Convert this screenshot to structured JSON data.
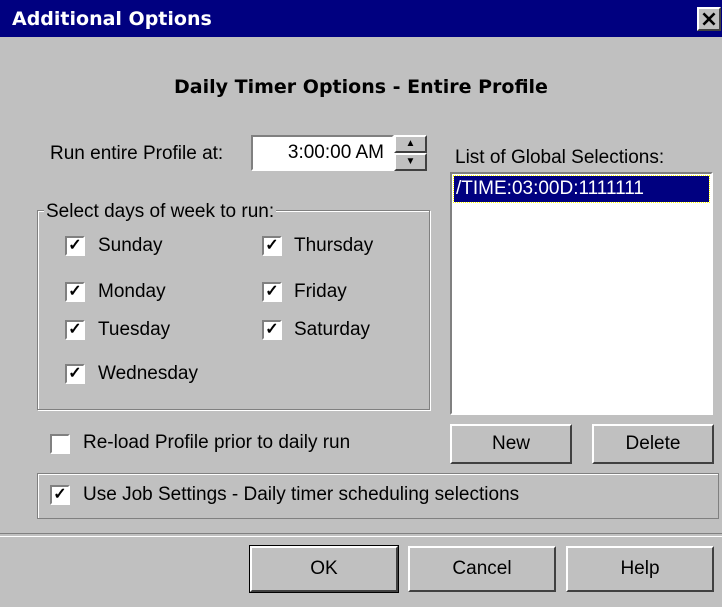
{
  "window": {
    "title": "Additional Options",
    "close_glyph": "×"
  },
  "heading": "Daily Timer Options - Entire Profile",
  "run_at": {
    "label": "Run entire Profile at:",
    "value": "3:00:00 AM"
  },
  "days_group": {
    "label": "Select days of week to run:",
    "days": [
      {
        "name": "Sunday",
        "checked": true
      },
      {
        "name": "Monday",
        "checked": true
      },
      {
        "name": "Tuesday",
        "checked": true
      },
      {
        "name": "Wednesday",
        "checked": true
      },
      {
        "name": "Thursday",
        "checked": true
      },
      {
        "name": "Friday",
        "checked": true
      },
      {
        "name": "Saturday",
        "checked": true
      }
    ]
  },
  "reload": {
    "label": "Re-load Profile prior to daily run",
    "checked": false
  },
  "global_list": {
    "label": "List of Global Selections:",
    "items": [
      "/TIME:03:00D:1111111"
    ]
  },
  "buttons": {
    "new": "New",
    "delete": "Delete",
    "ok": "OK",
    "cancel": "Cancel",
    "help": "Help"
  },
  "use_job": {
    "label": "Use  Job Settings - Daily timer scheduling selections",
    "checked": true
  },
  "check_glyph": "✓",
  "colors": {
    "title_bar": "#000080",
    "face": "#c0c0c0",
    "selection": "#000080"
  }
}
